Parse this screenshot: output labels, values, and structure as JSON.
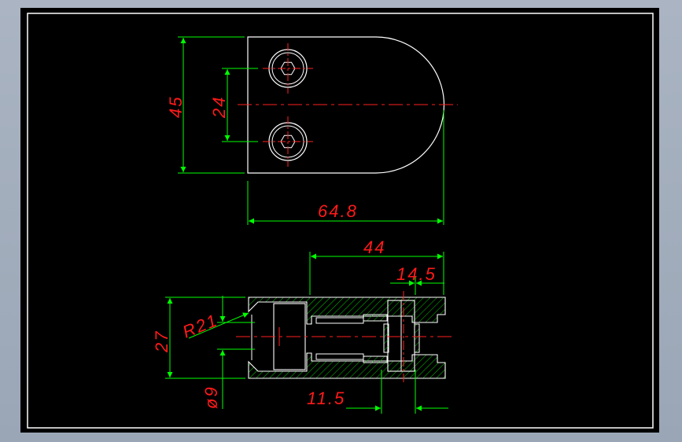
{
  "colors": {
    "background": "#000000",
    "outer_border": "#ffffff",
    "geometry": "#ffffff",
    "centerline": "#ff2020",
    "dimension_lines": "#00ff00",
    "dimension_text": "#ff1a1a",
    "hatch": "#00cc00"
  },
  "top_view": {
    "dims": {
      "height": "45",
      "hole_spacing": "24",
      "length": "64.8"
    }
  },
  "section_view": {
    "dims": {
      "length": "44",
      "offset": "14.5",
      "height": "27",
      "radius": "R21",
      "bore": "ø9",
      "screw_offset": "11.5"
    }
  }
}
